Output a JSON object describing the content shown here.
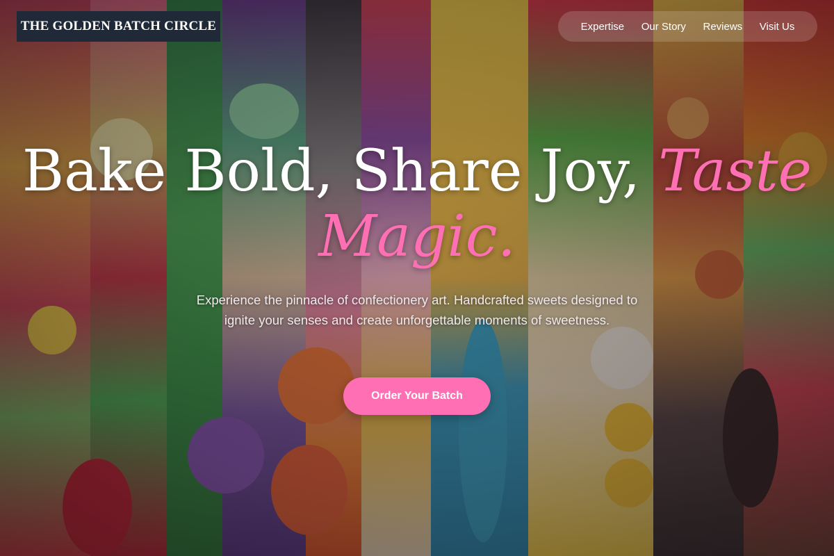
{
  "brand": {
    "name": "THE GOLDEN BATCH CIRCLE"
  },
  "nav": {
    "items": [
      {
        "label": "Expertise"
      },
      {
        "label": "Our Story"
      },
      {
        "label": "Reviews"
      },
      {
        "label": "Visit Us"
      }
    ]
  },
  "hero": {
    "title_plain": "Bake Bold, Share Joy,",
    "title_accent": "Taste Magic.",
    "subtitle": "Experience the pinnacle of confectionery art. Handcrafted sweets designed to ignite your senses and create unforgettable moments of sweetness.",
    "cta_label": "Order Your Batch"
  },
  "colors": {
    "accent": "#ff6fb3",
    "brand_bg": "#1f2937",
    "text": "#ffffff"
  },
  "background": {
    "subject": "assorted colorful gummy candies"
  }
}
